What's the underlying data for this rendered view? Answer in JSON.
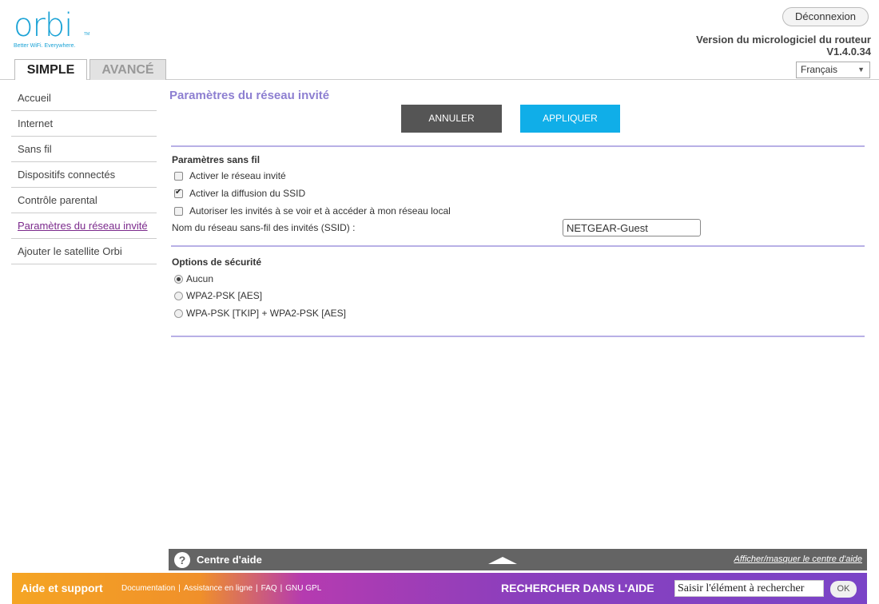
{
  "logo": {
    "word": "orbi",
    "tm": "TM",
    "tagline": "Better WiFi. Everywhere."
  },
  "header": {
    "logout_label": "Déconnexion",
    "firmware_label": "Version du micrologiciel du routeur",
    "firmware_version": "V1.4.0.34",
    "language": "Français"
  },
  "tabs": {
    "simple": "SIMPLE",
    "advanced": "AVANCÉ"
  },
  "sidebar": {
    "items": [
      {
        "label": "Accueil"
      },
      {
        "label": "Internet"
      },
      {
        "label": "Sans fil"
      },
      {
        "label": "Dispositifs connectés"
      },
      {
        "label": "Contrôle parental"
      },
      {
        "label": "Paramètres du réseau invité",
        "active": true
      },
      {
        "label": "Ajouter le satellite Orbi"
      }
    ]
  },
  "main": {
    "title": "Paramètres du réseau invité",
    "cancel_label": "ANNULER",
    "apply_label": "APPLIQUER",
    "wireless": {
      "title": "Paramètres sans fil",
      "options": [
        {
          "label": "Activer le réseau invité",
          "checked": false
        },
        {
          "label": "Activer la diffusion du SSID",
          "checked": true
        },
        {
          "label": "Autoriser les invités à se voir et à accéder à mon réseau local",
          "checked": false
        }
      ],
      "ssid_label": "Nom du réseau sans-fil des invités (SSID) :",
      "ssid_value": "NETGEAR-Guest"
    },
    "security": {
      "title": "Options de sécurité",
      "options": [
        {
          "label": "Aucun",
          "selected": true
        },
        {
          "label": "WPA2-PSK [AES]",
          "selected": false
        },
        {
          "label": "WPA-PSK [TKIP] + WPA2-PSK [AES]",
          "selected": false
        }
      ]
    }
  },
  "help": {
    "title": "Centre d'aide",
    "toggle_label": "Afficher/masquer le centre d'aide",
    "icon": "question-icon"
  },
  "footer": {
    "title": "Aide et support",
    "links": [
      "Documentation",
      "Assistance en ligne",
      "FAQ",
      "GNU GPL"
    ],
    "search_label": "RECHERCHER DANS L'AIDE",
    "search_value": "Saisir l'élément à rechercher",
    "ok_label": "OK"
  },
  "colors": {
    "brand": "#1ba3d6",
    "title": "#8d7fd1",
    "active_nav": "#7b2a8c",
    "apply": "#10aee8",
    "cancel": "#555555"
  }
}
